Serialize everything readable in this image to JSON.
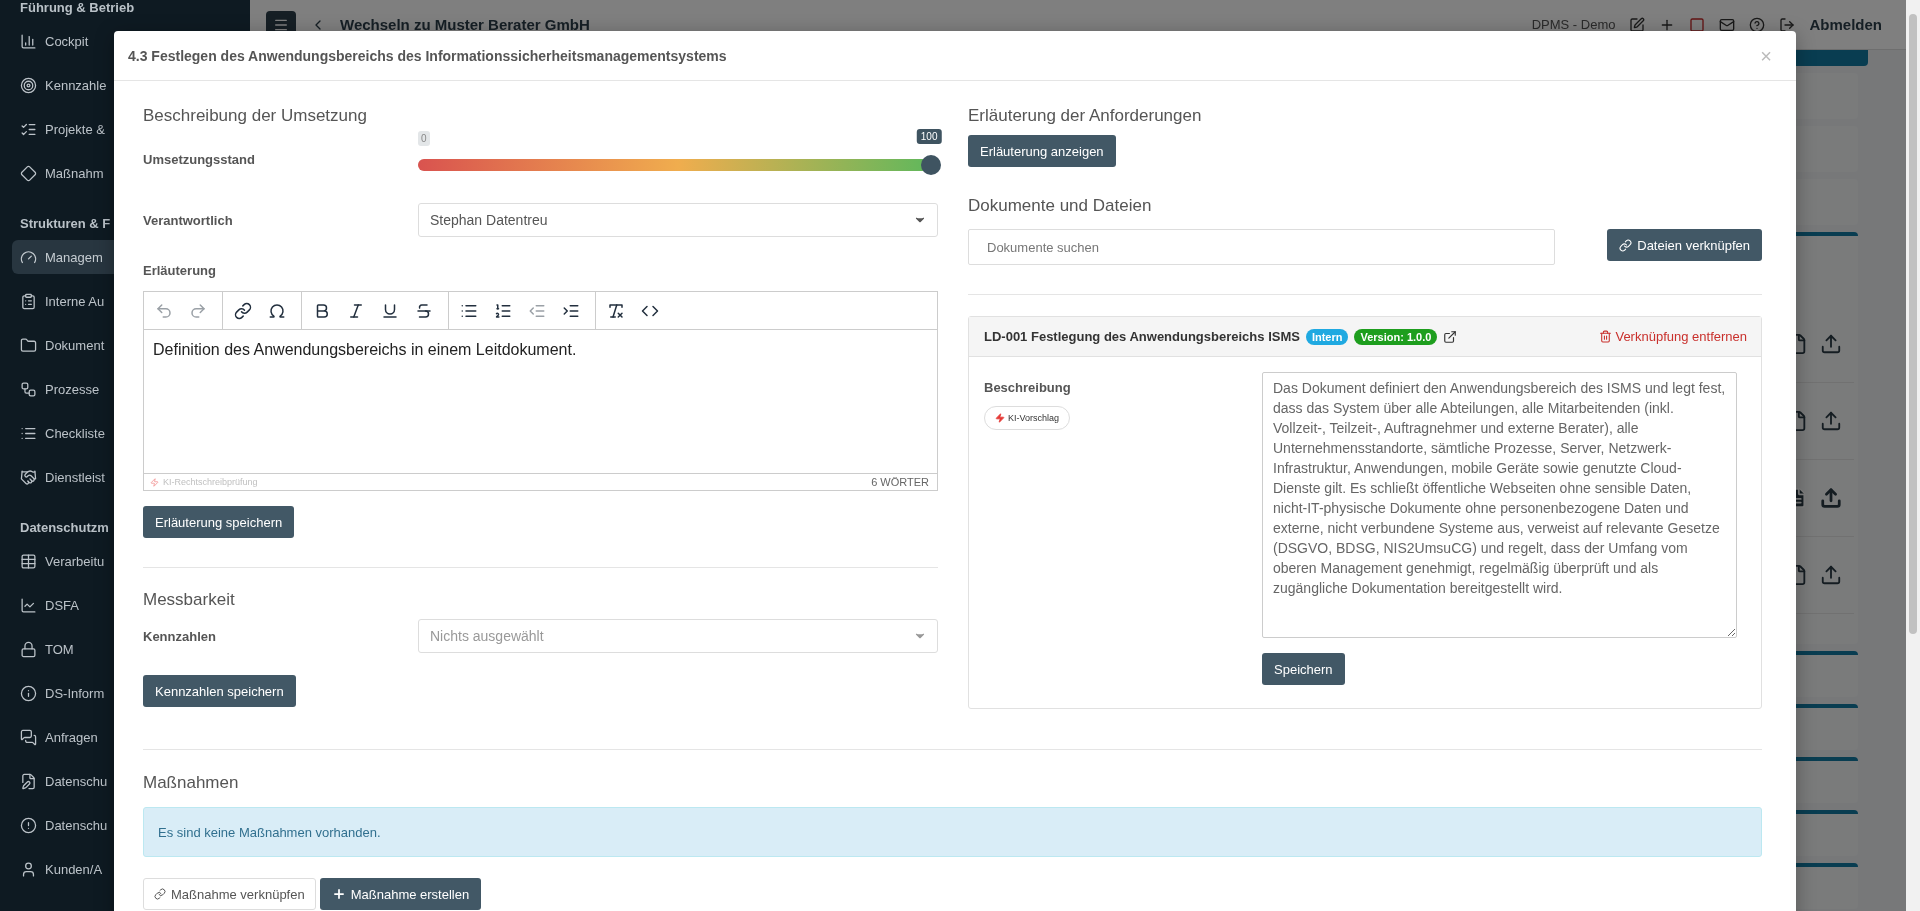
{
  "sidebar": {
    "sections": [
      {
        "heading": "Führung & Betrieb",
        "items": [
          {
            "label": "Cockpit",
            "selected": false
          },
          {
            "label": "Kennzahle",
            "selected": false
          },
          {
            "label": "Projekte &",
            "selected": false
          },
          {
            "label": "Maßnahm",
            "selected": false
          }
        ]
      },
      {
        "heading": "Strukturen & F",
        "items": [
          {
            "label": "Managem",
            "selected": true
          },
          {
            "label": "Interne Au",
            "selected": false
          },
          {
            "label": "Dokument",
            "selected": false
          },
          {
            "label": "Prozesse",
            "selected": false
          },
          {
            "label": "Checkliste",
            "selected": false
          },
          {
            "label": "Dienstleist",
            "selected": false
          }
        ]
      },
      {
        "heading": "Datenschutzm",
        "items": [
          {
            "label": "Verarbeitu",
            "selected": false
          },
          {
            "label": "DSFA",
            "selected": false
          },
          {
            "label": "TOM",
            "selected": false
          },
          {
            "label": "DS-Inform",
            "selected": false
          },
          {
            "label": "Anfragen",
            "selected": false
          },
          {
            "label": "Datenschu",
            "selected": false
          },
          {
            "label": "Datenschu",
            "selected": false
          },
          {
            "label": "Kunden/A",
            "selected": false
          }
        ]
      }
    ]
  },
  "topbar": {
    "switch_link": "Wechseln zu Muster Berater GmbH",
    "environment": "DPMS - Demo",
    "logout": "Abmelden"
  },
  "background_panel": {
    "file_rows": [
      {
        "filled": false
      },
      {
        "filled": false
      },
      {
        "filled": true
      },
      {
        "filled": false
      }
    ]
  },
  "modal": {
    "title": "4.3 Festlegen des Anwendungsbereichs des Informationssicherheitsmanagementsystems",
    "close": "×",
    "implementation": {
      "heading": "Beschreibung der Umsetzung",
      "progress": {
        "label": "Umsetzungsstand",
        "min_label": "0",
        "value_label": "100",
        "level": 1
      },
      "responsible": {
        "label": "Verantwortlich",
        "value": "Stephan Datentreu"
      },
      "explanation": {
        "label": "Erläuterung",
        "toolbar": [
          [
            {
              "kind": "undo",
              "disabled": true
            },
            {
              "kind": "redo",
              "disabled": true
            }
          ],
          [
            {
              "kind": "link",
              "disabled": false
            },
            {
              "kind": "special-character",
              "disabled": false
            }
          ],
          [
            {
              "kind": "bold",
              "disabled": false
            },
            {
              "kind": "italic",
              "disabled": false
            },
            {
              "kind": "underline",
              "disabled": false
            },
            {
              "kind": "strikethrough",
              "disabled": false
            }
          ],
          [
            {
              "kind": "bullet-list",
              "disabled": false
            },
            {
              "kind": "numbered-list",
              "disabled": false
            },
            {
              "kind": "outdent",
              "disabled": true
            },
            {
              "kind": "indent",
              "disabled": false
            }
          ],
          [
            {
              "kind": "clear-formatting",
              "disabled": false
            },
            {
              "kind": "source-code",
              "disabled": false
            }
          ]
        ],
        "content": "Definition des Anwendungsbereichs in einem Leitdokument.",
        "spellcheck": "KI-Rechtschreibprüfung",
        "word_count": "6 WÖRTER",
        "save_button": "Erläuterung speichern"
      }
    },
    "measurability": {
      "heading": "Messbarkeit",
      "label": "Kennzahlen",
      "placeholder": "Nichts ausgewählt",
      "save_button": "Kennzahlen speichern"
    },
    "requirements": {
      "heading": "Erläuterung der Anforderungen",
      "button": "Erläuterung anzeigen"
    },
    "documents": {
      "heading": "Dokumente und Dateien",
      "search_placeholder": "Dokumente suchen",
      "link_button": "Dateien verknüpfen",
      "items": [
        {
          "title": "LD-001 Festlegung des Anwendungsbereichs ISMS",
          "badges": [
            {
              "label": "Intern",
              "color": "#1fa9e1"
            },
            {
              "label": "Version: 1.0.0",
              "color": "#1e9e1e"
            }
          ],
          "remove_link": "Verknüpfung entfernen",
          "description_label": "Beschreibung",
          "ai_button": "KI-Vorschlag",
          "description": "Das Dokument definiert den Anwendungsbereich des ISMS und legt fest, dass das System über alle Abteilungen, alle Mitarbeitenden (inkl. Vollzeit-, Teilzeit-, Auftragnehmer und externe Berater), alle Unternehmensstandorte, sämtliche Prozesse, Server, Netzwerk-Infrastruktur, Anwendungen, mobile Geräte sowie genutzte Cloud-Dienste gilt. Es schließt öffentliche Webseiten ohne sensible Daten, nicht-IT-physische Dokumente ohne personenbezogene Daten und externe, nicht verbundene Systeme aus, verweist auf relevante Gesetze (DSGVO, BDSG, NIS2UmsuCG) und regelt, dass der Umfang vom oberen Management genehmigt, regelmäßig überprüft und als zugängliche Dokumentation bereitgestellt wird.",
          "save_button": "Speichern"
        }
      ]
    },
    "measures": {
      "heading": "Maßnahmen",
      "empty_notice": "Es sind keine Maßnahmen vorhanden.",
      "link_button": "Maßnahme verknüpfen",
      "create_button": "Maßnahme erstellen"
    }
  }
}
